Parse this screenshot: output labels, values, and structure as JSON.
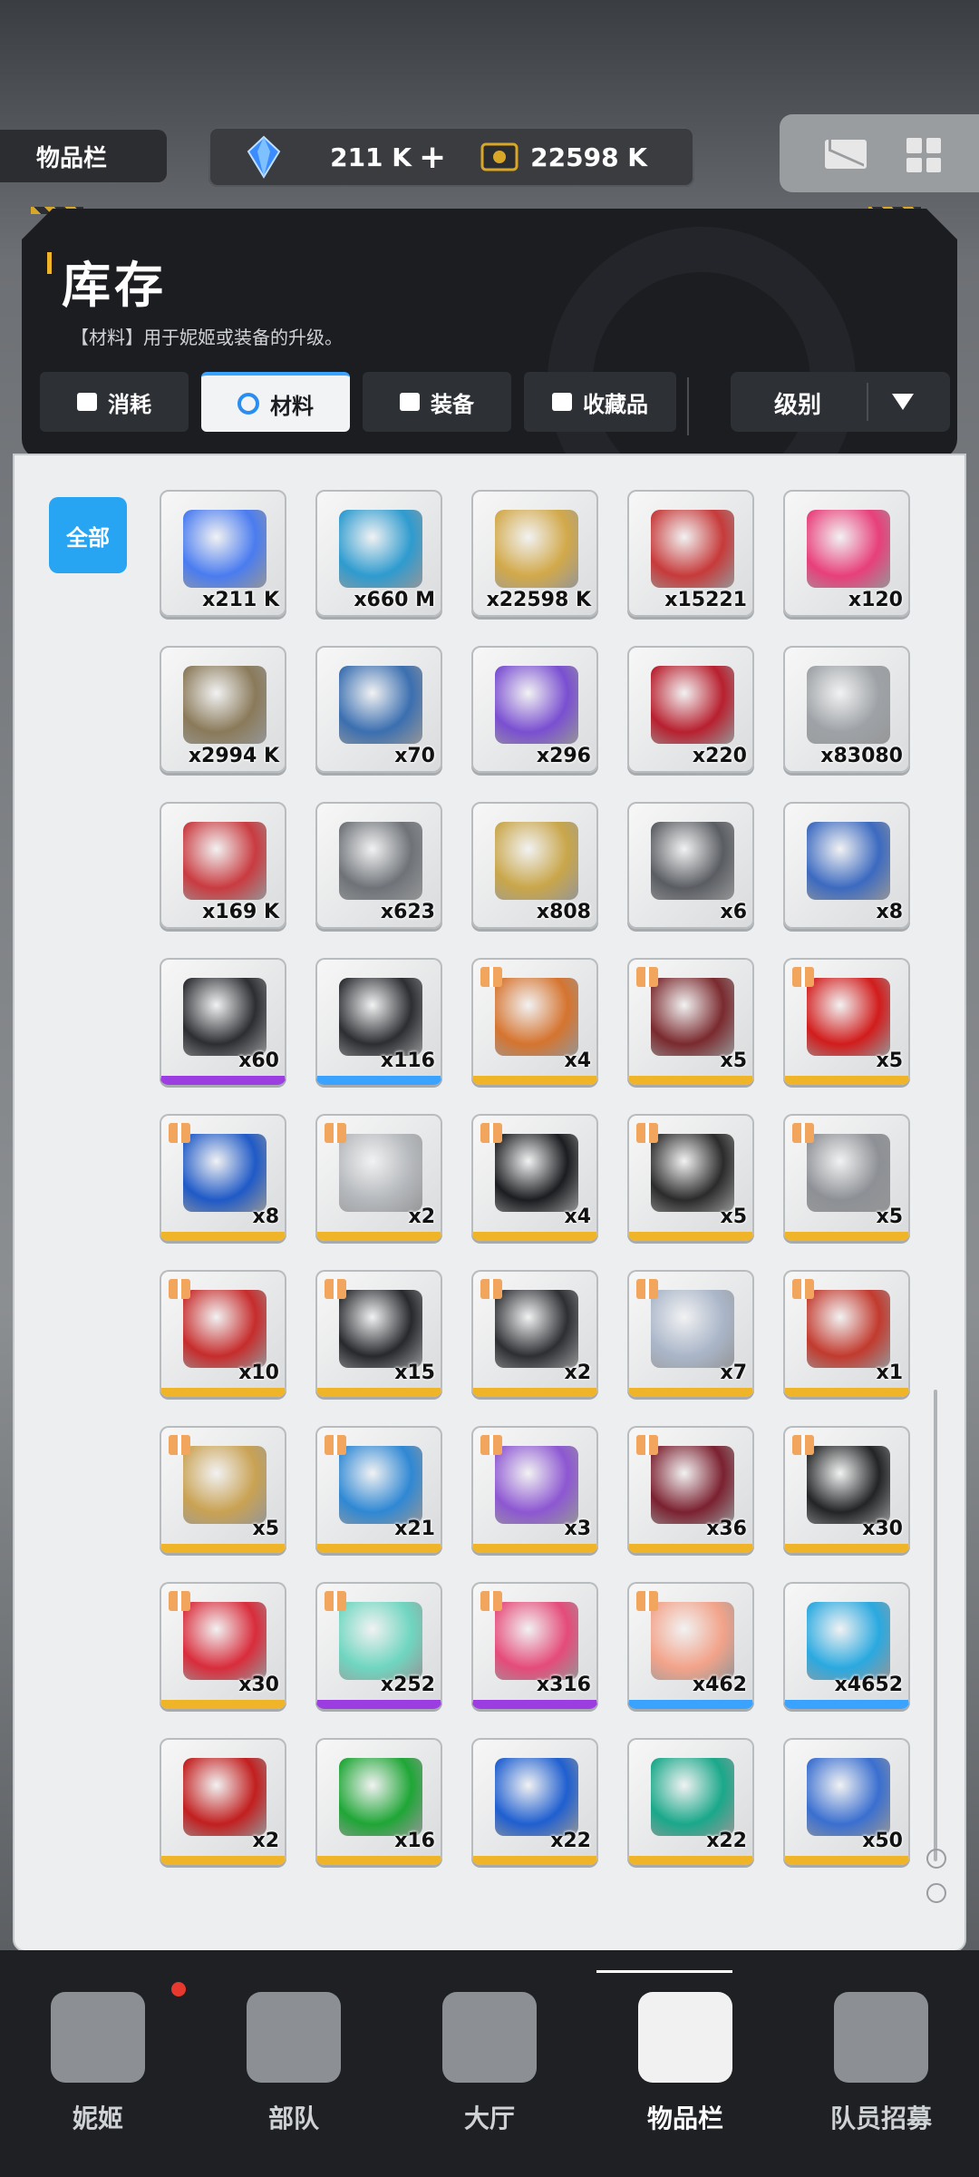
{
  "topbar": {
    "title": "物品栏",
    "currency1": {
      "value": "211 K",
      "icon": "diamond-crystal-icon",
      "color": "#3b8cff"
    },
    "currency2": {
      "value": "22598 K",
      "icon": "gold-card-icon",
      "color": "#d9a728"
    },
    "plus": "+",
    "mail_icon": "mail-icon",
    "menu_icon": "grid-menu-icon"
  },
  "panel": {
    "title": "库存",
    "description": "【材料】用于妮姬或装备的升级。",
    "tabs": [
      {
        "label": "消耗",
        "icon": "card-icon"
      },
      {
        "label": "材料",
        "icon": "hexagon-icon"
      },
      {
        "label": "装备",
        "icon": "armor-icon"
      },
      {
        "label": "收藏品",
        "icon": "cloud-icon"
      }
    ],
    "sort_label": "级别"
  },
  "filter": {
    "all": "全部"
  },
  "items": [
    {
      "qty": "x211 K",
      "color": "#4a7cf0"
    },
    {
      "qty": "x660 M",
      "color": "#2e9bcf"
    },
    {
      "qty": "x22598 K",
      "color": "#d2a94a"
    },
    {
      "qty": "x15221",
      "color": "#c73a3a"
    },
    {
      "qty": "x120",
      "color": "#e83f7a"
    },
    {
      "qty": "x2994 K",
      "color": "#8a7a5a"
    },
    {
      "qty": "x70",
      "color": "#3b6fb0"
    },
    {
      "qty": "x296",
      "color": "#7a4fd1"
    },
    {
      "qty": "x220",
      "color": "#b8202f"
    },
    {
      "qty": "x83080",
      "color": "#9ea2a6"
    },
    {
      "qty": "x169 K",
      "color": "#c93b40"
    },
    {
      "qty": "x623",
      "color": "#6f7378"
    },
    {
      "qty": "x808",
      "color": "#c9a64a"
    },
    {
      "qty": "x6",
      "color": "#5a5d62"
    },
    {
      "qty": "x8",
      "color": "#3c6ac0"
    },
    {
      "qty": "x60",
      "color": "#2c2e32"
    },
    {
      "qty": "x116",
      "color": "#2c2e32"
    },
    {
      "qty": "x4",
      "color": "#d5742f"
    },
    {
      "qty": "x5",
      "color": "#7a2a2e"
    },
    {
      "qty": "x5",
      "color": "#d21c1c"
    },
    {
      "qty": "x8",
      "color": "#1f5ac7"
    },
    {
      "qty": "x2",
      "color": "#b5b8bc"
    },
    {
      "qty": "x4",
      "color": "#1c1d20"
    },
    {
      "qty": "x5",
      "color": "#2b2b2b"
    },
    {
      "qty": "x5",
      "color": "#8d9095"
    },
    {
      "qty": "x10",
      "color": "#c72c2c"
    },
    {
      "qty": "x15",
      "color": "#27292d"
    },
    {
      "qty": "x2",
      "color": "#2e2f33"
    },
    {
      "qty": "x7",
      "color": "#aab6c9"
    },
    {
      "qty": "x1",
      "color": "#c23a2e"
    },
    {
      "qty": "x5",
      "color": "#c9a253"
    },
    {
      "qty": "x21",
      "color": "#2f88d4"
    },
    {
      "qty": "x3",
      "color": "#8d57d2"
    },
    {
      "qty": "x36",
      "color": "#7b2130"
    },
    {
      "qty": "x30",
      "color": "#222425"
    },
    {
      "qty": "x30",
      "color": "#d92c3b"
    },
    {
      "qty": "x252",
      "color": "#6fd6c0"
    },
    {
      "qty": "x316",
      "color": "#e54b7a"
    },
    {
      "qty": "x462",
      "color": "#f2a38a"
    },
    {
      "qty": "x4652",
      "color": "#2aa9e0"
    },
    {
      "qty": "x2",
      "color": "#c21f1f"
    },
    {
      "qty": "x16",
      "color": "#1fa636"
    },
    {
      "qty": "x22",
      "color": "#1f5fd0"
    },
    {
      "qty": "x22",
      "color": "#1aa88a"
    },
    {
      "qty": "x50",
      "color": "#3a6fd0"
    }
  ],
  "bottom_nav": [
    {
      "label": "妮姬",
      "icon": "nikke-icon"
    },
    {
      "label": "部队",
      "icon": "squad-icon"
    },
    {
      "label": "大厅",
      "icon": "lobby-icon"
    },
    {
      "label": "物品栏",
      "icon": "inventory-icon"
    },
    {
      "label": "队员招募",
      "icon": "recruit-icon"
    }
  ],
  "colors": {
    "accent": "#27a4f2",
    "gold": "#f0b429",
    "purple": "#9b3de0",
    "blue": "#3aa2ff"
  }
}
